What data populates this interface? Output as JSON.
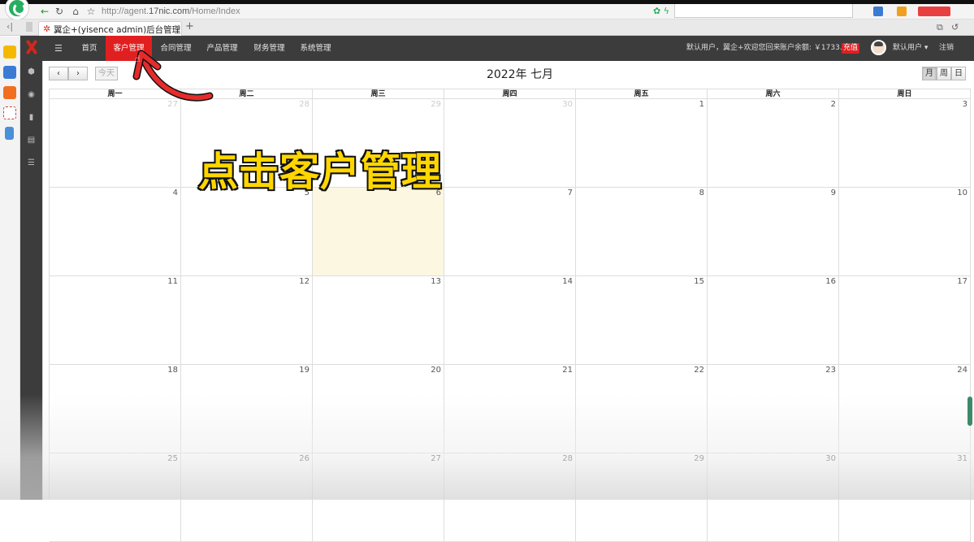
{
  "browser": {
    "url_prefix": "http://agent.",
    "url_domain": "17nic.com",
    "url_path": "/Home/Index",
    "tab_title": "翼企+(yisence admin)后台管理",
    "back_icon": "arrow-left-icon",
    "refresh_icon": "refresh-icon",
    "home_icon": "home-icon",
    "star_icon": "star-icon"
  },
  "nav": {
    "menu_icon": "menu-icon",
    "items": [
      "首页",
      "客户管理",
      "合同管理",
      "产品管理",
      "财务管理",
      "系统管理"
    ],
    "active_index": 1,
    "welcome": "默认用户，翼企+欢迎您回来",
    "balance": "账户余额: ￥1733.06",
    "recharge": "充值",
    "user": "默认用户",
    "logout": "注销"
  },
  "calendar": {
    "prev": "‹",
    "next": "›",
    "today": "今天",
    "title": "2022年 七月",
    "views": [
      "月",
      "周",
      "日"
    ],
    "active_view": 0,
    "weekdays": [
      "周一",
      "周二",
      "周三",
      "周四",
      "周五",
      "周六",
      "周日"
    ],
    "weeks": [
      [
        {
          "d": "27",
          "o": true
        },
        {
          "d": "28",
          "o": true
        },
        {
          "d": "29",
          "o": true
        },
        {
          "d": "30",
          "o": true
        },
        {
          "d": "1"
        },
        {
          "d": "2"
        },
        {
          "d": "3"
        }
      ],
      [
        {
          "d": "4"
        },
        {
          "d": "5"
        },
        {
          "d": "6",
          "t": true
        },
        {
          "d": "7"
        },
        {
          "d": "8"
        },
        {
          "d": "9"
        },
        {
          "d": "10"
        }
      ],
      [
        {
          "d": "11"
        },
        {
          "d": "12"
        },
        {
          "d": "13"
        },
        {
          "d": "14"
        },
        {
          "d": "15"
        },
        {
          "d": "16"
        },
        {
          "d": "17"
        }
      ],
      [
        {
          "d": "18"
        },
        {
          "d": "19"
        },
        {
          "d": "20"
        },
        {
          "d": "21"
        },
        {
          "d": "22"
        },
        {
          "d": "23"
        },
        {
          "d": "24"
        }
      ],
      [
        {
          "d": "25"
        },
        {
          "d": "26"
        },
        {
          "d": "27"
        },
        {
          "d": "28"
        },
        {
          "d": "29"
        },
        {
          "d": "30"
        },
        {
          "d": "31"
        }
      ]
    ]
  },
  "annotation": {
    "caption": "点击客户管理"
  },
  "colors": {
    "accent": "#e02020",
    "navbar": "#3c3c3c",
    "today": "#fcf7e1",
    "caption": "#ffd600"
  }
}
